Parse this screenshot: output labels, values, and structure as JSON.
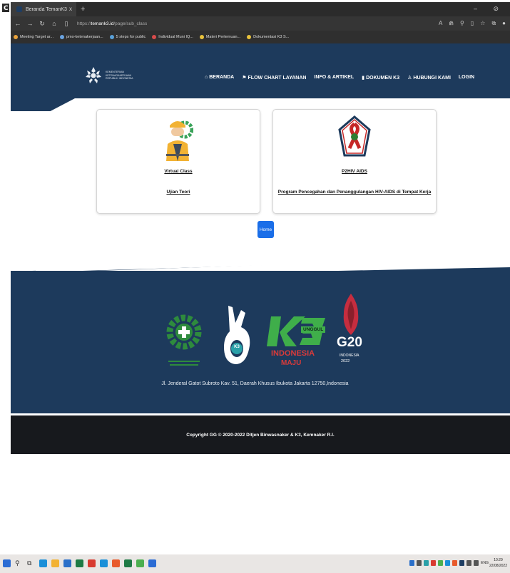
{
  "browser": {
    "tab_title": "Beranda TemanK3",
    "tab_close": "x",
    "new_tab": "+",
    "window_controls": "– ⊘",
    "url_prefix": "https://",
    "url_host": "temank3.id",
    "url_path": "/page/sub_class",
    "bookmarks": [
      "Meeting Target ar...",
      "pmo-ketenakerjaan...",
      "5 steps for public",
      "Individual Muni IQ...",
      "Materi Pertemuan...",
      "Dokumentasi K3 S..."
    ]
  },
  "site": {
    "logo_text": "KEMENTERIAN KETENAGAKERJAAN REPUBLIK INDONESIA",
    "nav": [
      {
        "icon": "home-icon",
        "label": "BERANDA"
      },
      {
        "icon": "flag-icon",
        "label": "FLOW CHART LAYANAN"
      },
      {
        "icon": "none",
        "label": "INFO & ARTIKEL"
      },
      {
        "icon": "document-icon",
        "label": "DOKUMEN K3"
      },
      {
        "icon": "user-icon",
        "label": "HUBUNGI KAMI"
      },
      {
        "icon": "none",
        "label": "LOGIN"
      }
    ],
    "cards": [
      {
        "title": "Virtual Class",
        "link": "Ujian Teori"
      },
      {
        "title": "P2HIV AIDS",
        "link": "Program Pencegahan dan Penanggulangan HIV-AIDS di Tempat Kerja"
      }
    ],
    "home_button": "Home",
    "footer_logos": {
      "k3_badge": "K3",
      "unggul": "UNGGUL",
      "indonesia": "INDONESIA",
      "maju": "MAJU",
      "g20": "G20",
      "g20_sub1": "INDONESIA",
      "g20_sub2": "2022"
    },
    "address": "Jl. Jenderal Gatot Subroto Kav. 51, Daerah Khusus Ibukota Jakarta 12750,Indonesia",
    "copyright": "Copyright GG © 2020-2022 Ditjen Binwasnaker & K3, Kemnaker R.I."
  },
  "taskbar": {
    "time": "10:29",
    "date": "22/08/2022",
    "lang": "ENG"
  },
  "colors": {
    "header": "#1d3a5c",
    "accent": "#1a6ee8",
    "footer_bar": "#17191d"
  }
}
